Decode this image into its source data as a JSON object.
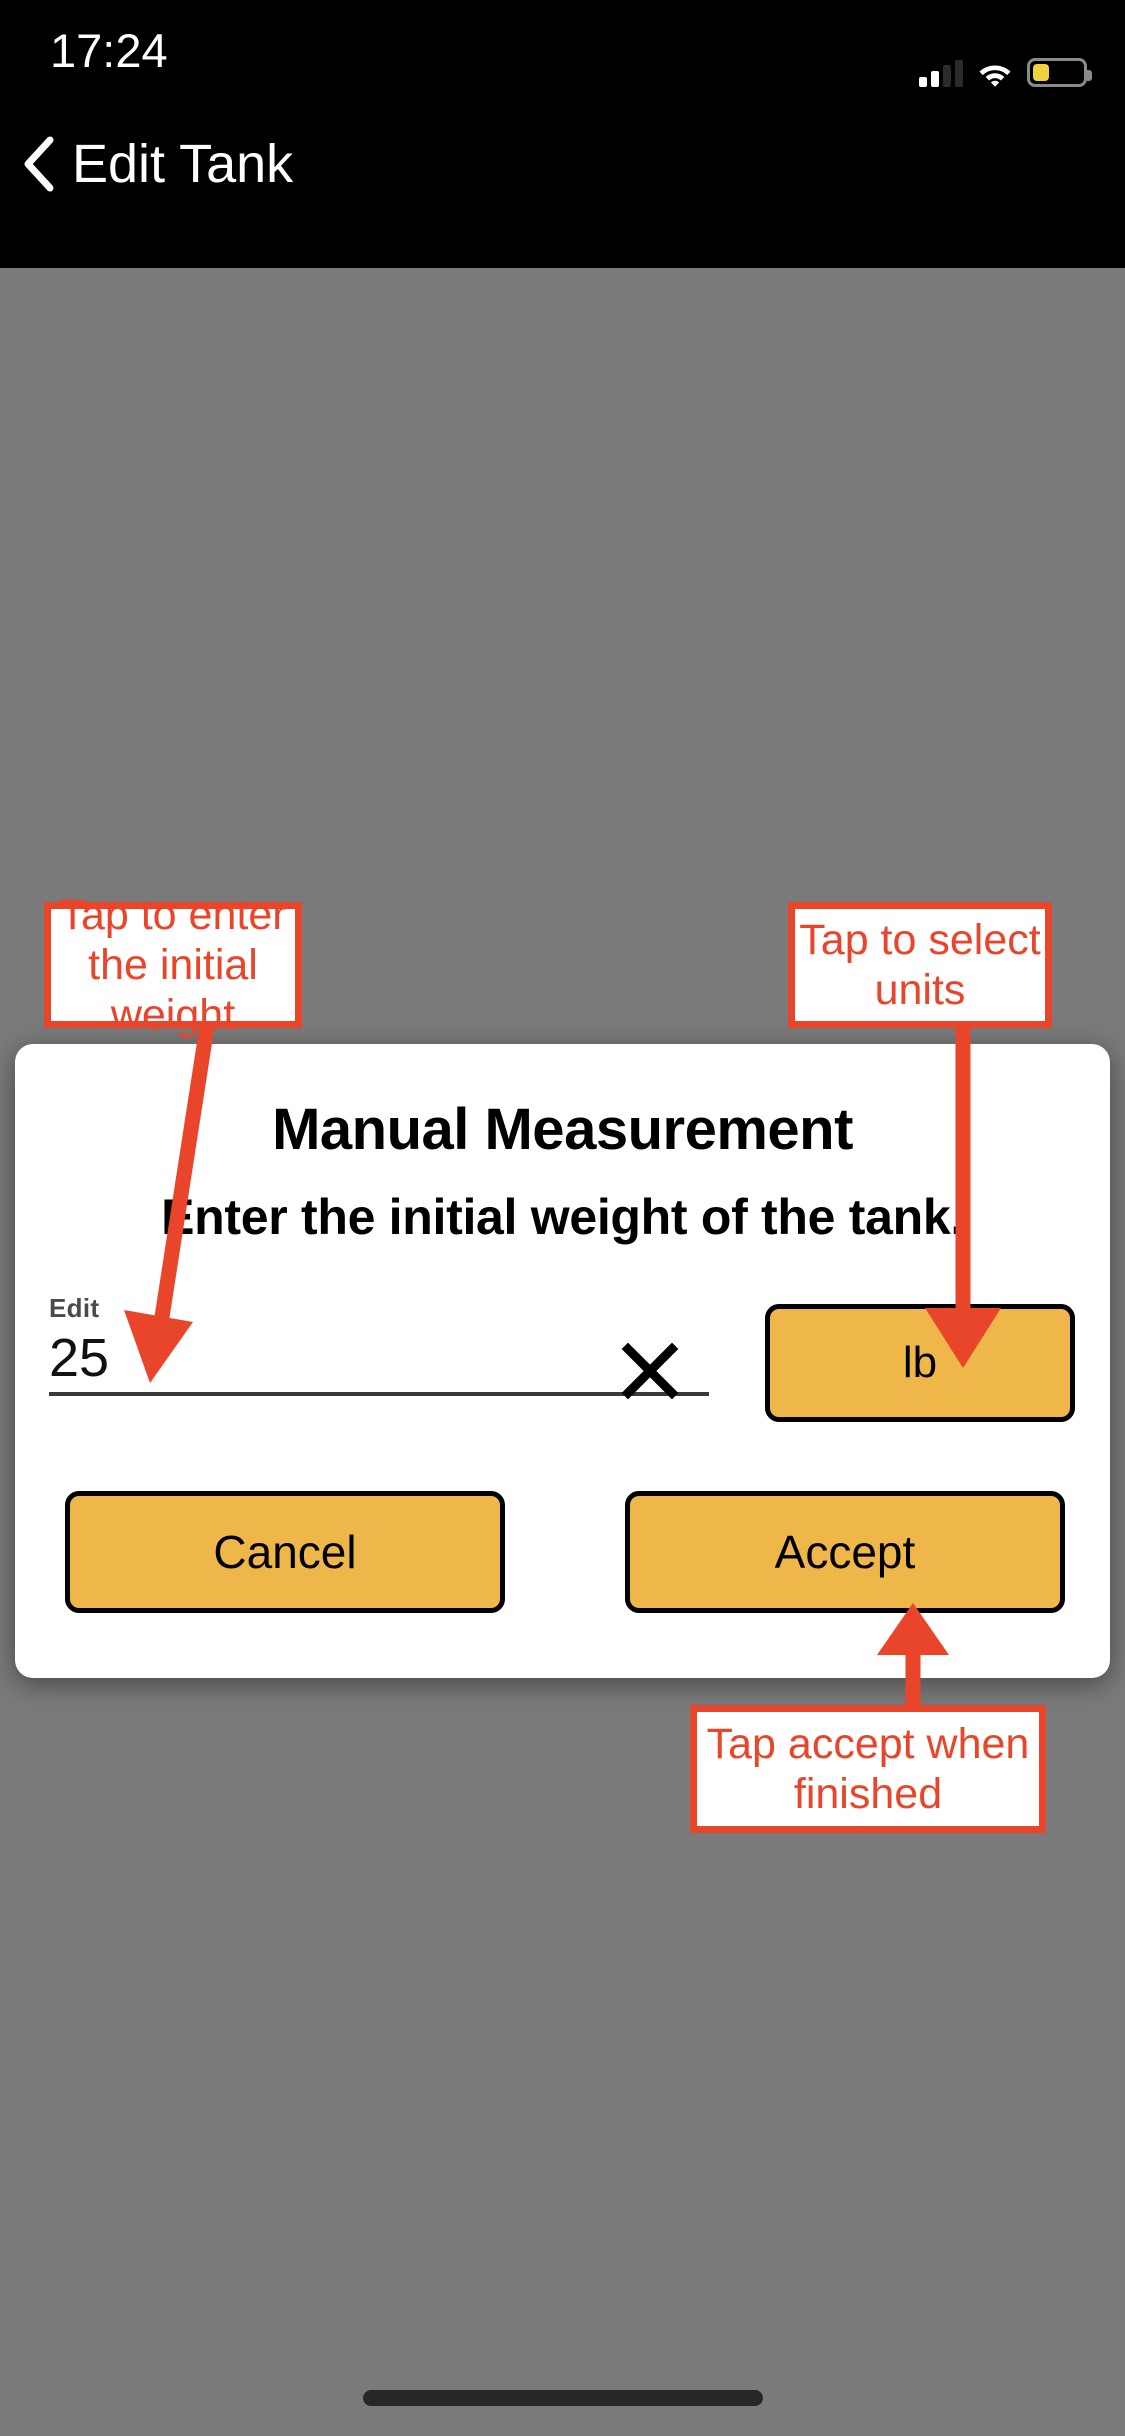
{
  "status_bar": {
    "time": "17:24",
    "cellular_icon": "cellular-signal-icon",
    "wifi_icon": "wifi-icon",
    "battery_icon": "battery-low-power-icon"
  },
  "nav": {
    "back_icon": "back-chevron-icon",
    "title": "Edit Tank"
  },
  "dialog": {
    "title": "Manual Measurement",
    "subtitle": "Enter the initial weight of the tank.",
    "input": {
      "label": "Edit",
      "value": "25",
      "placeholder": "",
      "clear_icon": "close-x-icon"
    },
    "units_button_label": "lb",
    "cancel_button_label": "Cancel",
    "accept_button_label": "Accept"
  },
  "annotations": [
    {
      "id": "weight",
      "text": "Tap to enter the initial weight"
    },
    {
      "id": "units",
      "text": "Tap to select units"
    },
    {
      "id": "accept",
      "text": "Tap accept when finished"
    }
  ],
  "annotation_texts": {
    "weight": "Tap to enter the initial weight",
    "units": "Tap to select units",
    "accept": "Tap accept when finished"
  },
  "colors": {
    "annotation_red": "#e8452a",
    "button_amber": "#efb74a",
    "overlay_gray": "#7a7a7a",
    "status_bar_black": "#000000",
    "battery_yellow": "#f2d23c"
  }
}
